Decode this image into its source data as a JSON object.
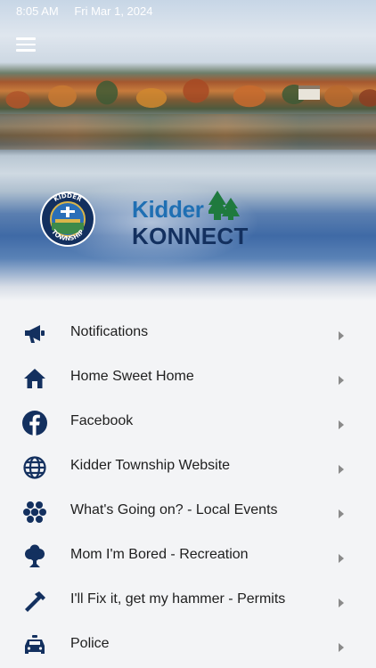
{
  "status_bar": {
    "time": "8:05 AM",
    "date": "Fri Mar 1, 2024"
  },
  "header": {
    "seal_text": "KIDDER TOWNSHIP",
    "logo_line1": "Kidder",
    "logo_line2": "KONNECT"
  },
  "colors": {
    "icon_navy": "#13305f",
    "logo_blue": "#1f6fb3",
    "logo_green": "#1f7a3e",
    "chevron_gray": "#8a8a8a"
  },
  "menu": {
    "items": [
      {
        "label": "Notifications",
        "icon": "megaphone-icon"
      },
      {
        "label": "Home Sweet Home",
        "icon": "home-icon"
      },
      {
        "label": "Facebook",
        "icon": "facebook-icon"
      },
      {
        "label": "Kidder Township Website",
        "icon": "globe-icon"
      },
      {
        "label": "What's Going on? - Local Events",
        "icon": "people-group-icon"
      },
      {
        "label": "Mom I'm Bored - Recreation",
        "icon": "tree-icon"
      },
      {
        "label": "I'll Fix it, get my hammer - Permits",
        "icon": "hammer-icon"
      },
      {
        "label": "Police",
        "icon": "police-car-icon"
      }
    ]
  }
}
